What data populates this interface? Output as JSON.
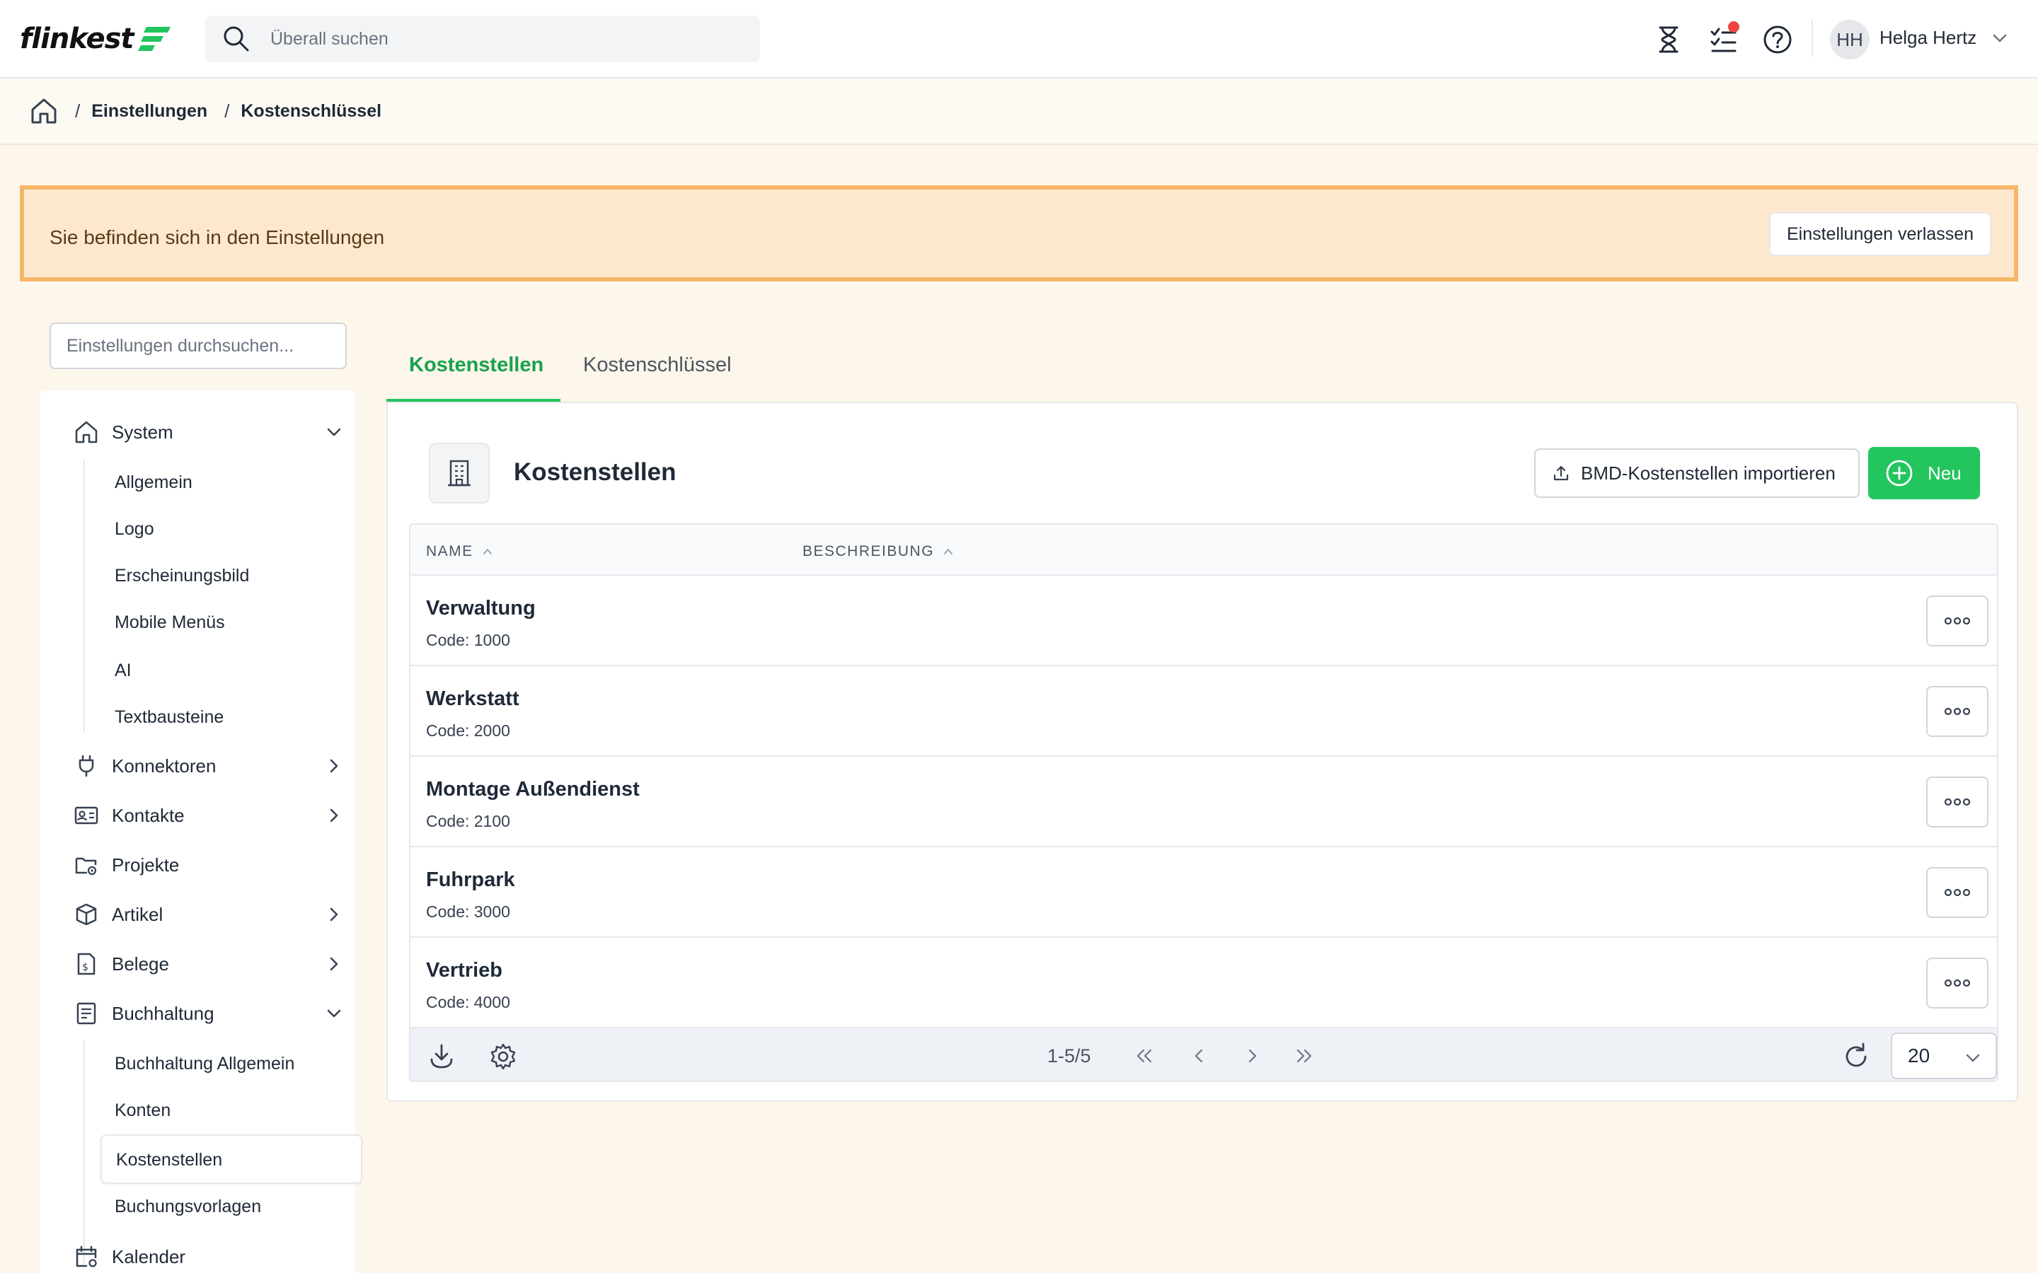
{
  "header": {
    "logo_text": "flinkest",
    "search_placeholder": "Überall suchen",
    "user_initials": "HH",
    "user_name": "Helga Hertz"
  },
  "breadcrumb": [
    "Einstellungen",
    "Kostenschlüssel"
  ],
  "banner": {
    "text": "Sie befinden sich in den Einstellungen",
    "button": "Einstellungen verlassen"
  },
  "sidebar": {
    "search_placeholder": "Einstellungen durchsuchen...",
    "items": [
      {
        "label": "System",
        "icon": "home-icon",
        "expanded": true,
        "children": [
          "Allgemein",
          "Logo",
          "Erscheinungsbild",
          "Mobile Menüs",
          "AI",
          "Textbausteine"
        ]
      },
      {
        "label": "Konnektoren",
        "icon": "plug-icon",
        "expandable": true
      },
      {
        "label": "Kontakte",
        "icon": "contact-card-icon",
        "expandable": true
      },
      {
        "label": "Projekte",
        "icon": "folder-gear-icon"
      },
      {
        "label": "Artikel",
        "icon": "box-icon",
        "expandable": true
      },
      {
        "label": "Belege",
        "icon": "receipt-icon",
        "expandable": true
      },
      {
        "label": "Buchhaltung",
        "icon": "ledger-icon",
        "expanded": true,
        "children": [
          "Buchhaltung Allgemein",
          "Konten",
          "Kostenstellen",
          "Buchungsvorlagen"
        ]
      },
      {
        "label": "Kalender",
        "icon": "calendar-gear-icon"
      }
    ],
    "active_child": "Kostenstellen"
  },
  "tabs": [
    {
      "label": "Kostenstellen",
      "active": true
    },
    {
      "label": "Kostenschlüssel",
      "active": false
    }
  ],
  "card": {
    "title": "Kostenstellen",
    "import_button": "BMD-Kostenstellen importieren",
    "new_button": "Neu"
  },
  "table": {
    "columns": [
      "NAME",
      "BESCHREIBUNG"
    ],
    "rows": [
      {
        "name": "Verwaltung",
        "code": "Code: 1000"
      },
      {
        "name": "Werkstatt",
        "code": "Code: 2000"
      },
      {
        "name": "Montage Außendienst",
        "code": "Code: 2100"
      },
      {
        "name": "Fuhrpark",
        "code": "Code: 3000"
      },
      {
        "name": "Vertrieb",
        "code": "Code: 4000"
      }
    ],
    "range": "1-5/5",
    "page_size": "20"
  },
  "colors": {
    "accent": "#22c55e",
    "banner_bg": "#fde8cf",
    "banner_border": "#f7b76a",
    "page_bg": "#fdf6ea",
    "notification": "#ef4444"
  }
}
